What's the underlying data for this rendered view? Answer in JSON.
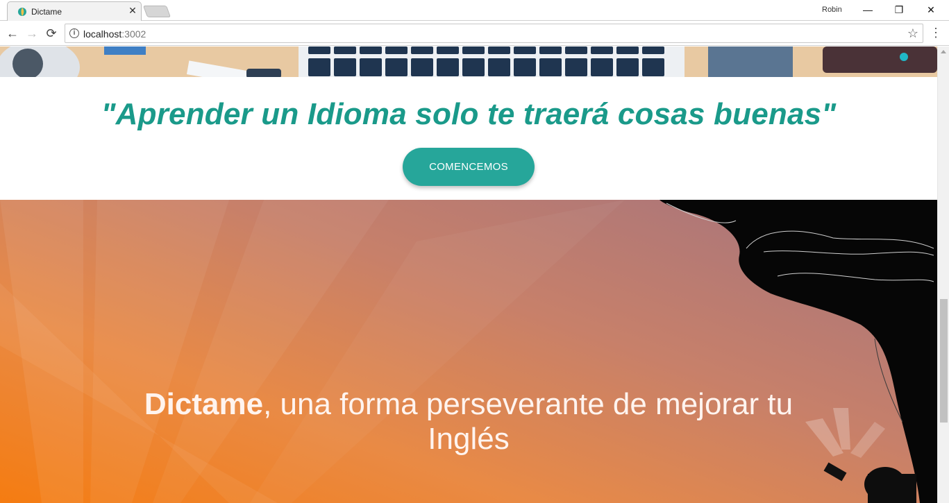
{
  "browser": {
    "tab_title": "Dictame",
    "tab_close": "✕",
    "profile_name": "Robin",
    "url_host": "localhost",
    "url_port": ":3002",
    "window_controls": {
      "minimize": "—",
      "restore": "❐",
      "close": "✕"
    },
    "nav": {
      "back": "←",
      "forward": "→",
      "reload": "⟳"
    },
    "info_icon": "i",
    "star_icon": "☆",
    "menu_icon": "⋮"
  },
  "quote_section": {
    "quote": "\"Aprender un Idioma solo te traerá cosas buenas\"",
    "cta_label": "COMENCEMOS",
    "quote_color": "#1a9a8a",
    "cta_color": "#26a69a"
  },
  "hero": {
    "brand": "Dictame",
    "tagline_line1": ", una forma perseverante de mejorar tu",
    "tagline_line2": "Inglés",
    "gradient_colors": [
      "#f57c11",
      "#e98a45",
      "#c7806a",
      "#a2737f"
    ]
  }
}
